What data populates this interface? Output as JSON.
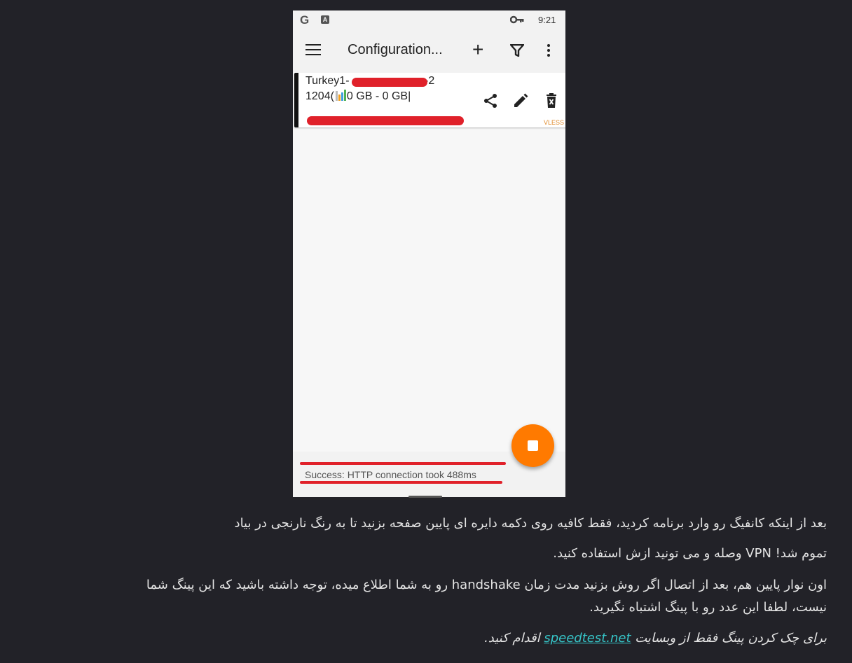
{
  "statusbar": {
    "g_icon": "G",
    "a_icon": "A",
    "key_icon": "key-icon",
    "time": "9:21"
  },
  "toolbar": {
    "title": "Configuration...",
    "add_label": "+"
  },
  "config": {
    "name_prefix": "Turkey1-",
    "name_suffix": "-2",
    "stats_prefix": "1204(",
    "stats_suffix": "0 GB - 0 GB|",
    "protocol": "VLESS"
  },
  "status": {
    "message": "Success: HTTP connection took 488ms"
  },
  "colors": {
    "fab": "#ff7a00",
    "redaction": "#e0212a",
    "link": "#36c4c7",
    "background": "#222228"
  },
  "article": {
    "p1": "بعد از اینکه کانفیگ رو وارد برنامه کردید، فقط کافیه روی دکمه دایره ای پایین صفحه بزنید تا به رنگ نارنجی در بیاد",
    "p2": "تموم شد! VPN وصله و می تونید ازش استفاده کنید.",
    "p3": "اون نوار پایین هم، بعد از اتصال اگر روش بزنید مدت زمان handshake رو به شما اطلاع میده، توجه داشته باشید که این پینگ شما نیست، لطفا این عدد رو با پینگ اشتباه نگیرید.",
    "p4_before": "برای چک کردن پینگ فقط از وبسایت ",
    "p4_link": "speedtest.net",
    "p4_after": " اقدام کنید."
  }
}
